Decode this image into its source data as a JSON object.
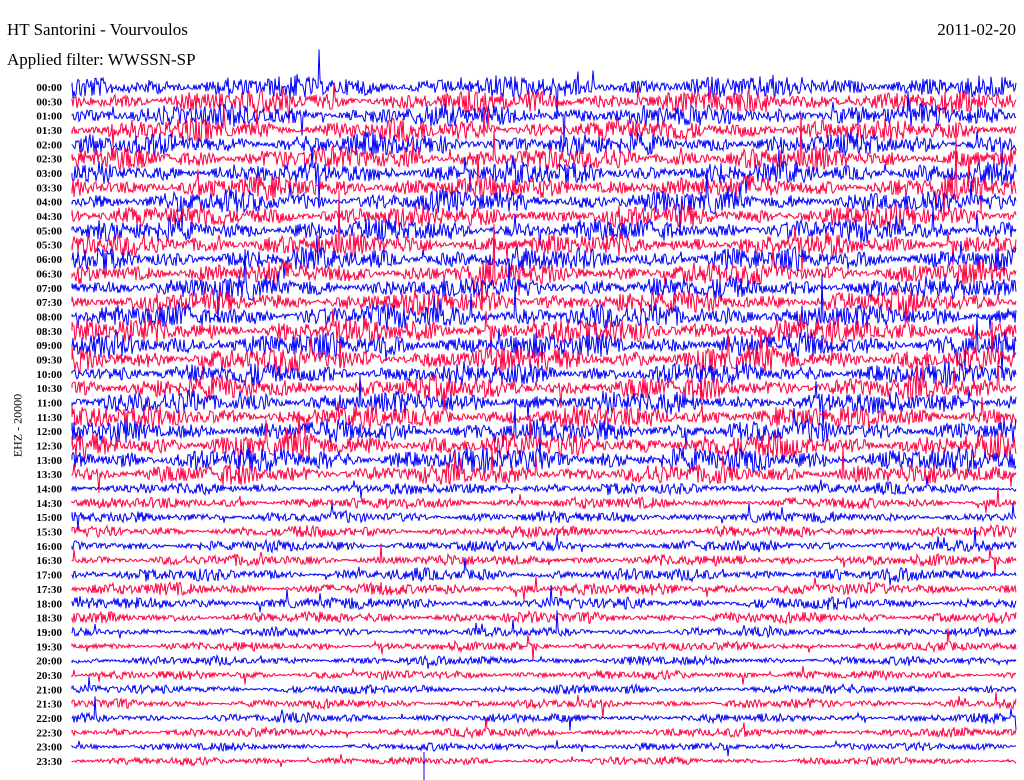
{
  "header": {
    "station": "HT Santorini - Vourvoulos",
    "date": "2011-02-20",
    "filter": "Applied filter: WWSSN-SP"
  },
  "chart_data": {
    "type": "line",
    "title": "HT Santorini - Vourvoulos",
    "ylabel": "EHZ - 20000",
    "xlabel": "",
    "row_labels": [
      "00:00",
      "00:30",
      "01:00",
      "01:30",
      "02:00",
      "02:30",
      "03:00",
      "03:30",
      "04:00",
      "04:30",
      "05:00",
      "05:30",
      "06:00",
      "06:30",
      "07:00",
      "07:30",
      "08:00",
      "08:30",
      "09:00",
      "09:30",
      "10:00",
      "10:30",
      "11:00",
      "11:30",
      "12:00",
      "12:30",
      "13:00",
      "13:30",
      "14:00",
      "14:30",
      "15:00",
      "15:30",
      "16:00",
      "16:30",
      "17:00",
      "17:30",
      "18:00",
      "18:30",
      "19:00",
      "19:30",
      "20:00",
      "20:30",
      "21:00",
      "21:30",
      "22:00",
      "22:30",
      "23:00",
      "23:30"
    ],
    "relative_amplitude": [
      1.0,
      1.0,
      1.0,
      1.0,
      1.0,
      1.0,
      1.0,
      1.0,
      1.0,
      1.0,
      1.0,
      1.0,
      1.0,
      1.0,
      1.0,
      1.0,
      1.1,
      1.1,
      1.1,
      1.1,
      1.0,
      1.0,
      1.0,
      1.0,
      1.0,
      1.1,
      1.1,
      0.9,
      0.5,
      0.5,
      0.5,
      0.5,
      0.5,
      0.5,
      0.55,
      0.55,
      0.55,
      0.5,
      0.4,
      0.4,
      0.4,
      0.4,
      0.4,
      0.4,
      0.4,
      0.4,
      0.35,
      0.35
    ],
    "series_colors": [
      "#0000ff",
      "#ff0040"
    ]
  }
}
